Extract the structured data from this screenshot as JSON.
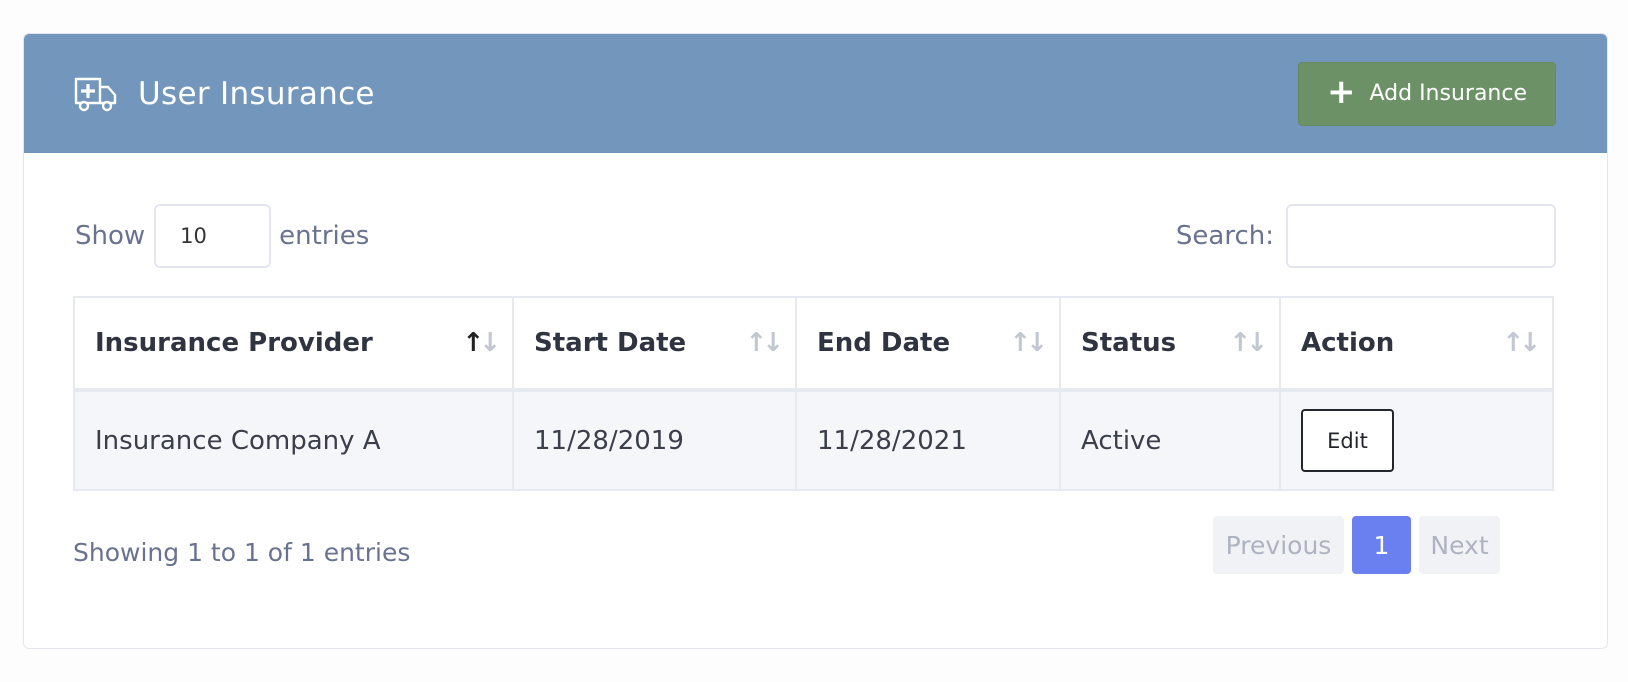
{
  "header": {
    "title": "User Insurance",
    "icon": "ambulance-icon",
    "add_button": {
      "label": "Add Insurance",
      "icon": "plus-icon"
    }
  },
  "controls": {
    "show_label": "Show",
    "page_length": "10",
    "entries_label": "entries",
    "search_label": "Search:",
    "search_value": ""
  },
  "table": {
    "columns": [
      "Insurance Provider",
      "Start Date",
      "End Date",
      "Status",
      "Action"
    ],
    "sorted_column": "Insurance Provider",
    "sort_direction": "ascending",
    "rows": [
      {
        "provider": "Insurance Company A",
        "start_date": "11/28/2019",
        "end_date": "11/28/2021",
        "status": "Active",
        "action_label": "Edit"
      }
    ]
  },
  "footer": {
    "info": "Showing 1 to 1 of 1 entries",
    "pagination": {
      "previous": "Previous",
      "current": "1",
      "next": "Next"
    }
  },
  "colors": {
    "header_bg": "#7397bc",
    "add_button_bg": "#6c9166",
    "active_page_bg": "#6b80f0"
  }
}
